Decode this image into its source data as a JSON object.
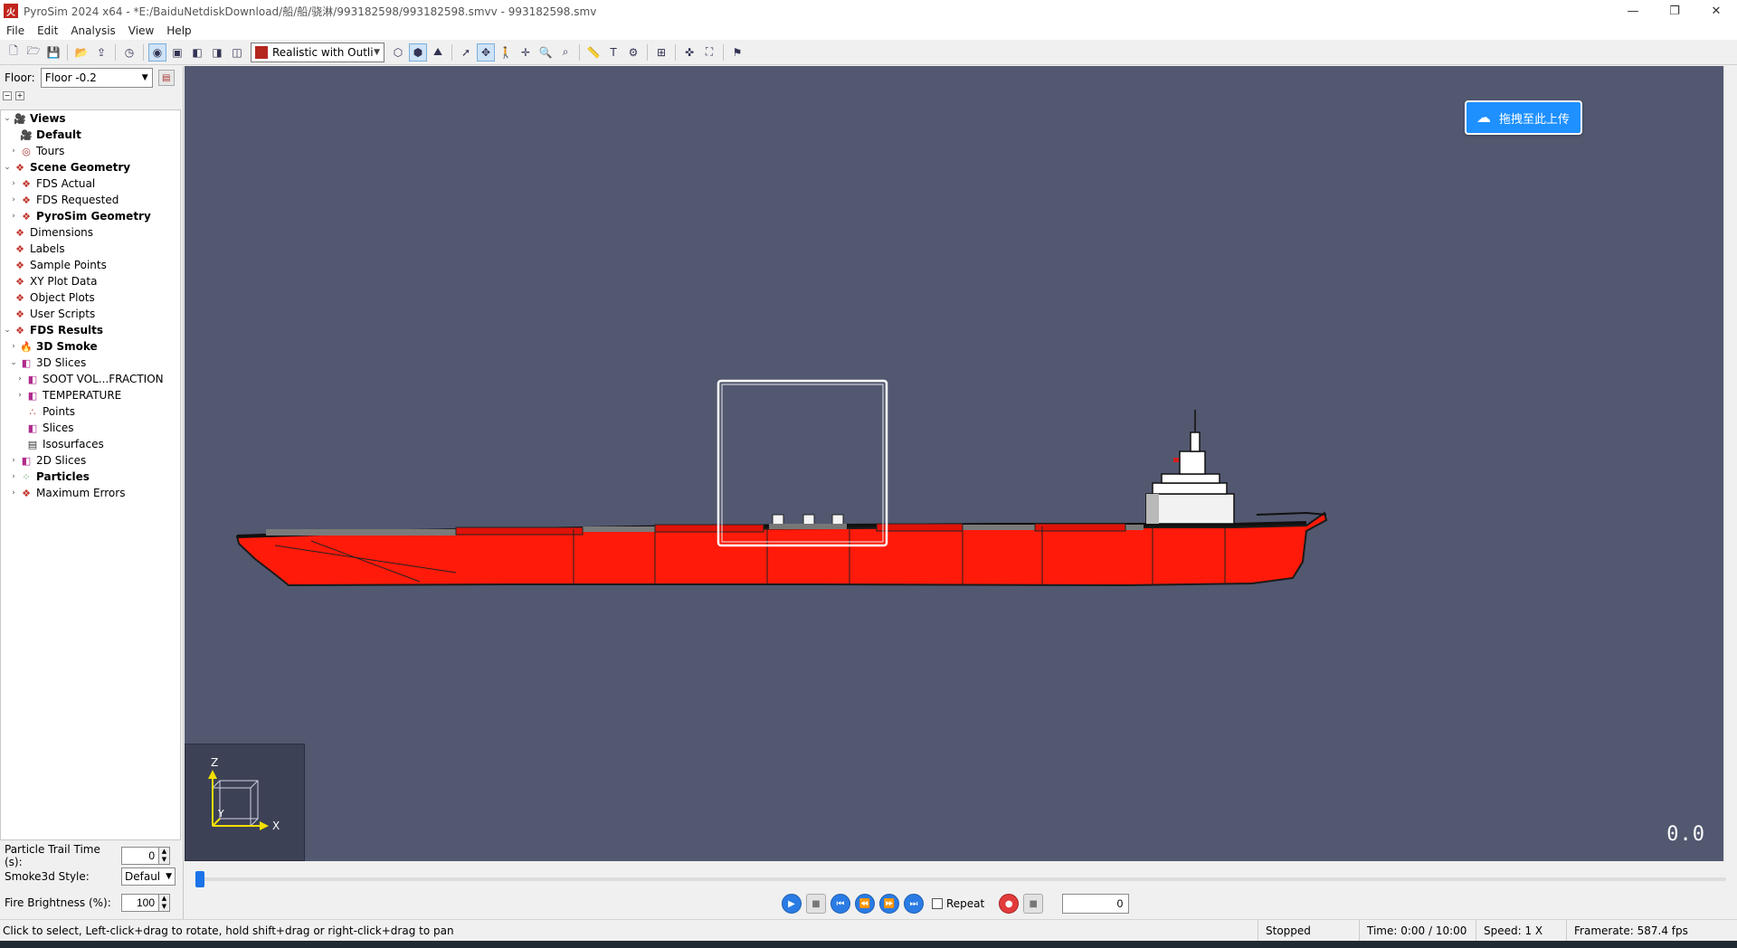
{
  "titlebar": {
    "logo_text": "火",
    "title": "PyroSim 2024 x64 - *E:/BaiduNetdiskDownload/船/船/骁淋/993182598/993182598.smvv - 993182598.smv",
    "minimize": "—",
    "restore": "❐",
    "close": "✕"
  },
  "menu": [
    "File",
    "Edit",
    "Analysis",
    "View",
    "Help"
  ],
  "toolbar": {
    "render_mode": "Realistic with Outli",
    "buttons": [
      "new-file",
      "open-file",
      "save",
      "open-results",
      "export",
      "timer",
      "view-mode-1",
      "view-mode-2",
      "view-mode-3",
      "view-mode-4",
      "view-mode-5"
    ]
  },
  "floor": {
    "label": "Floor:",
    "value": "Floor -0.2"
  },
  "tree": [
    {
      "label": "Views",
      "level": 0,
      "bold": true,
      "expander": "v",
      "icon": "camera-icon"
    },
    {
      "label": "Default",
      "level": 1,
      "bold": true,
      "expander": "",
      "icon": "camera-icon"
    },
    {
      "label": "Tours",
      "level": 1,
      "bold": false,
      "expander": ">",
      "icon": "tour-icon"
    },
    {
      "label": "Scene Geometry",
      "level": 0,
      "bold": true,
      "expander": "v",
      "icon": "geometry-icon"
    },
    {
      "label": "FDS Actual",
      "level": 1,
      "bold": false,
      "expander": ">",
      "icon": "geometry-icon"
    },
    {
      "label": "FDS Requested",
      "level": 1,
      "bold": false,
      "expander": ">",
      "icon": "geometry-icon"
    },
    {
      "label": "PyroSim Geometry",
      "level": 1,
      "bold": true,
      "expander": ">",
      "icon": "geometry-icon"
    },
    {
      "label": "Dimensions",
      "level": 0,
      "bold": false,
      "expander": "",
      "icon": "geometry-icon"
    },
    {
      "label": "Labels",
      "level": 0,
      "bold": false,
      "expander": "",
      "icon": "geometry-icon"
    },
    {
      "label": "Sample Points",
      "level": 0,
      "bold": false,
      "expander": "",
      "icon": "geometry-icon"
    },
    {
      "label": "XY Plot Data",
      "level": 0,
      "bold": false,
      "expander": "",
      "icon": "geometry-icon"
    },
    {
      "label": "Object Plots",
      "level": 0,
      "bold": false,
      "expander": "",
      "icon": "geometry-icon"
    },
    {
      "label": "User Scripts",
      "level": 0,
      "bold": false,
      "expander": "",
      "icon": "geometry-icon"
    },
    {
      "label": "FDS Results",
      "level": 0,
      "bold": true,
      "expander": "v",
      "icon": "geometry-icon"
    },
    {
      "label": "3D Smoke",
      "level": 1,
      "bold": true,
      "expander": ">",
      "icon": "smoke-icon"
    },
    {
      "label": "3D Slices",
      "level": 1,
      "bold": false,
      "expander": "v",
      "icon": "slice-icon"
    },
    {
      "label": "SOOT VOL...FRACTION",
      "level": 2,
      "bold": false,
      "expander": ">",
      "icon": "slice-icon"
    },
    {
      "label": "TEMPERATURE",
      "level": 2,
      "bold": false,
      "expander": ">",
      "icon": "slice-icon"
    },
    {
      "label": "Points",
      "level": 2,
      "bold": false,
      "expander": "",
      "icon": "points-icon"
    },
    {
      "label": "Slices",
      "level": 2,
      "bold": false,
      "expander": "",
      "icon": "slice-icon"
    },
    {
      "label": "Isosurfaces",
      "level": 2,
      "bold": false,
      "expander": "",
      "icon": "isosurface-icon"
    },
    {
      "label": "2D Slices",
      "level": 1,
      "bold": false,
      "expander": ">",
      "icon": "slice-icon"
    },
    {
      "label": "Particles",
      "level": 1,
      "bold": true,
      "expander": ">",
      "icon": "particles-icon"
    },
    {
      "label": "Maximum Errors",
      "level": 1,
      "bold": false,
      "expander": ">",
      "icon": "geometry-icon"
    }
  ],
  "properties": {
    "trail_label": "Particle Trail Time (s):",
    "trail_value": "0",
    "smoke_style_label": "Smoke3d Style:",
    "smoke_style_value": "Defaul",
    "brightness_label": "Fire Brightness (%):",
    "brightness_value": "100"
  },
  "viewport": {
    "upload_badge": "拖拽至此上传",
    "fps_overlay": "0.0",
    "axis_z": "Z",
    "axis_y": "Y",
    "axis_x": "X",
    "hull_color": "#ff1a0a",
    "background": "#525870"
  },
  "playback": {
    "repeat_label": "Repeat",
    "repeat_checked": false,
    "frame": "0",
    "progress": 0
  },
  "status": {
    "message": "Click to select, Left-click+drag to rotate, hold shift+drag or right-click+drag to pan",
    "state": "Stopped",
    "time": "Time: 0:00 / 10:00",
    "speed": "Speed: 1 X",
    "framerate": "Framerate: 587.4 fps"
  }
}
